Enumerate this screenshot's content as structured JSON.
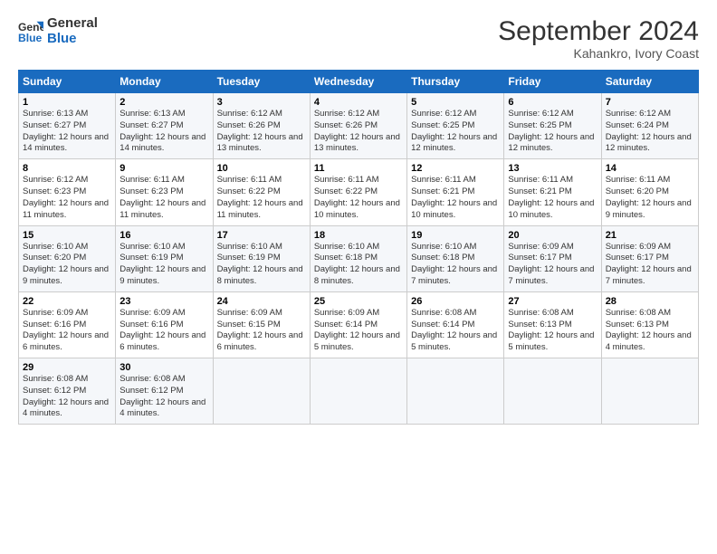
{
  "logo": {
    "line1": "General",
    "line2": "Blue"
  },
  "title": "September 2024",
  "subtitle": "Kahankro, Ivory Coast",
  "weekdays": [
    "Sunday",
    "Monday",
    "Tuesday",
    "Wednesday",
    "Thursday",
    "Friday",
    "Saturday"
  ],
  "weeks": [
    [
      {
        "day": 1,
        "sunrise": "6:13 AM",
        "sunset": "6:27 PM",
        "daylight": "12 hours and 14 minutes."
      },
      {
        "day": 2,
        "sunrise": "6:13 AM",
        "sunset": "6:27 PM",
        "daylight": "12 hours and 14 minutes."
      },
      {
        "day": 3,
        "sunrise": "6:12 AM",
        "sunset": "6:26 PM",
        "daylight": "12 hours and 13 minutes."
      },
      {
        "day": 4,
        "sunrise": "6:12 AM",
        "sunset": "6:26 PM",
        "daylight": "12 hours and 13 minutes."
      },
      {
        "day": 5,
        "sunrise": "6:12 AM",
        "sunset": "6:25 PM",
        "daylight": "12 hours and 12 minutes."
      },
      {
        "day": 6,
        "sunrise": "6:12 AM",
        "sunset": "6:25 PM",
        "daylight": "12 hours and 12 minutes."
      },
      {
        "day": 7,
        "sunrise": "6:12 AM",
        "sunset": "6:24 PM",
        "daylight": "12 hours and 12 minutes."
      }
    ],
    [
      {
        "day": 8,
        "sunrise": "6:12 AM",
        "sunset": "6:23 PM",
        "daylight": "12 hours and 11 minutes."
      },
      {
        "day": 9,
        "sunrise": "6:11 AM",
        "sunset": "6:23 PM",
        "daylight": "12 hours and 11 minutes."
      },
      {
        "day": 10,
        "sunrise": "6:11 AM",
        "sunset": "6:22 PM",
        "daylight": "12 hours and 11 minutes."
      },
      {
        "day": 11,
        "sunrise": "6:11 AM",
        "sunset": "6:22 PM",
        "daylight": "12 hours and 10 minutes."
      },
      {
        "day": 12,
        "sunrise": "6:11 AM",
        "sunset": "6:21 PM",
        "daylight": "12 hours and 10 minutes."
      },
      {
        "day": 13,
        "sunrise": "6:11 AM",
        "sunset": "6:21 PM",
        "daylight": "12 hours and 10 minutes."
      },
      {
        "day": 14,
        "sunrise": "6:11 AM",
        "sunset": "6:20 PM",
        "daylight": "12 hours and 9 minutes."
      }
    ],
    [
      {
        "day": 15,
        "sunrise": "6:10 AM",
        "sunset": "6:20 PM",
        "daylight": "12 hours and 9 minutes."
      },
      {
        "day": 16,
        "sunrise": "6:10 AM",
        "sunset": "6:19 PM",
        "daylight": "12 hours and 9 minutes."
      },
      {
        "day": 17,
        "sunrise": "6:10 AM",
        "sunset": "6:19 PM",
        "daylight": "12 hours and 8 minutes."
      },
      {
        "day": 18,
        "sunrise": "6:10 AM",
        "sunset": "6:18 PM",
        "daylight": "12 hours and 8 minutes."
      },
      {
        "day": 19,
        "sunrise": "6:10 AM",
        "sunset": "6:18 PM",
        "daylight": "12 hours and 7 minutes."
      },
      {
        "day": 20,
        "sunrise": "6:09 AM",
        "sunset": "6:17 PM",
        "daylight": "12 hours and 7 minutes."
      },
      {
        "day": 21,
        "sunrise": "6:09 AM",
        "sunset": "6:17 PM",
        "daylight": "12 hours and 7 minutes."
      }
    ],
    [
      {
        "day": 22,
        "sunrise": "6:09 AM",
        "sunset": "6:16 PM",
        "daylight": "12 hours and 6 minutes."
      },
      {
        "day": 23,
        "sunrise": "6:09 AM",
        "sunset": "6:16 PM",
        "daylight": "12 hours and 6 minutes."
      },
      {
        "day": 24,
        "sunrise": "6:09 AM",
        "sunset": "6:15 PM",
        "daylight": "12 hours and 6 minutes."
      },
      {
        "day": 25,
        "sunrise": "6:09 AM",
        "sunset": "6:14 PM",
        "daylight": "12 hours and 5 minutes."
      },
      {
        "day": 26,
        "sunrise": "6:08 AM",
        "sunset": "6:14 PM",
        "daylight": "12 hours and 5 minutes."
      },
      {
        "day": 27,
        "sunrise": "6:08 AM",
        "sunset": "6:13 PM",
        "daylight": "12 hours and 5 minutes."
      },
      {
        "day": 28,
        "sunrise": "6:08 AM",
        "sunset": "6:13 PM",
        "daylight": "12 hours and 4 minutes."
      }
    ],
    [
      {
        "day": 29,
        "sunrise": "6:08 AM",
        "sunset": "6:12 PM",
        "daylight": "12 hours and 4 minutes."
      },
      {
        "day": 30,
        "sunrise": "6:08 AM",
        "sunset": "6:12 PM",
        "daylight": "12 hours and 4 minutes."
      },
      null,
      null,
      null,
      null,
      null
    ]
  ]
}
